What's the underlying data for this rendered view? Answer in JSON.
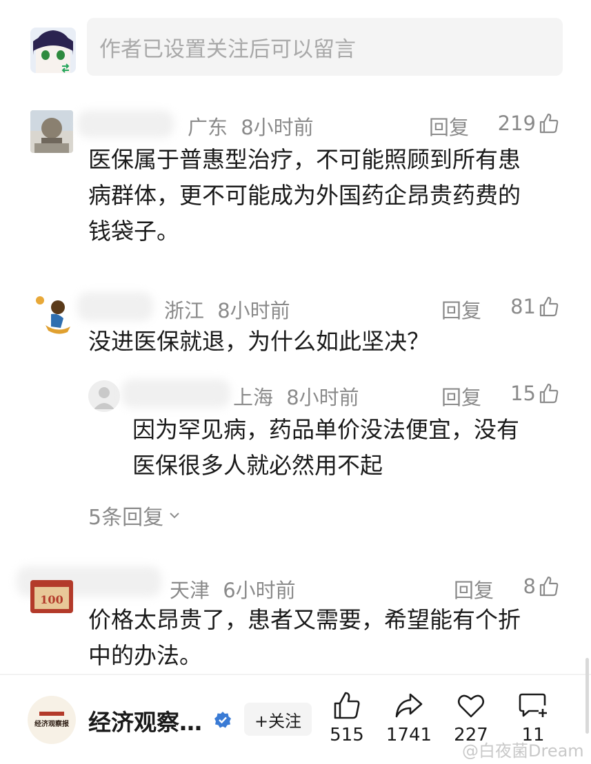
{
  "comment_input": {
    "placeholder": "作者已设置关注后可以留言"
  },
  "comments": [
    {
      "location": "广东",
      "time": "8小时前",
      "reply_label": "回复",
      "likes": "219",
      "text_lines": [
        "医保属于普惠型治疗，不可能照顾到所有患",
        "病群体，更不可能成为外国药企昂贵药费的",
        "钱袋子。"
      ]
    },
    {
      "location": "浙江",
      "time": "8小时前",
      "reply_label": "回复",
      "likes": "81",
      "text_lines": [
        "没进医保就退，为什么如此坚决？"
      ],
      "sub_reply": {
        "location": "上海",
        "time": "8小时前",
        "reply_label": "回复",
        "likes": "15",
        "text_lines": [
          "因为罕见病，药品单价没法便宜，没有",
          "医保很多人就必然用不起"
        ]
      },
      "more_replies": "5条回复"
    },
    {
      "location": "天津",
      "time": "6小时前",
      "reply_label": "回复",
      "likes": "8",
      "text_lines": [
        "价格太昂贵了，患者又需要，希望能有个折",
        "中的办法。"
      ]
    }
  ],
  "bottom_bar": {
    "publisher_logo_text": "经济观察报",
    "publisher_name": "经济观察…",
    "follow_label": "+关注",
    "actions": [
      {
        "name": "like",
        "icon": "thumb-up-icon",
        "count": "515"
      },
      {
        "name": "share",
        "icon": "share-icon",
        "count": "1741"
      },
      {
        "name": "favorite",
        "icon": "heart-icon",
        "count": "227"
      },
      {
        "name": "comment",
        "icon": "comment-add-icon",
        "count": "11"
      }
    ]
  },
  "watermark": "@白夜菌Dream",
  "colors": {
    "meta": "#8a8a8a",
    "text": "#1a1a1a",
    "input_bg": "#f4f4f4",
    "verified": "#3a7bd5"
  }
}
